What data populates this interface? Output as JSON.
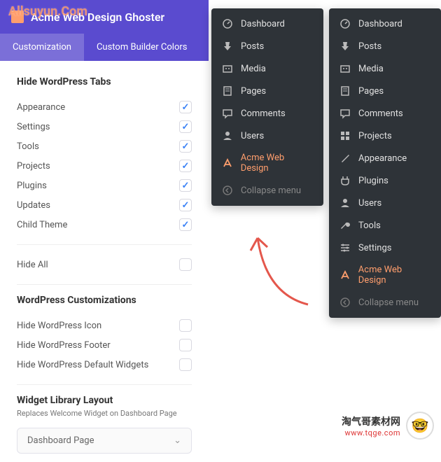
{
  "watermarks": {
    "top": "Allsuyun.Com",
    "bottom_title": "淘气哥素材网",
    "bottom_url": "www.tqge.com"
  },
  "panel": {
    "title": "Acme Web Design Ghoster",
    "tabs": [
      "Customization",
      "Custom Builder Colors"
    ],
    "active_tab": 0,
    "sections": {
      "hide_tabs": {
        "title": "Hide WordPress Tabs",
        "items": [
          {
            "label": "Appearance",
            "checked": true
          },
          {
            "label": "Settings",
            "checked": true
          },
          {
            "label": "Tools",
            "checked": true
          },
          {
            "label": "Projects",
            "checked": true
          },
          {
            "label": "Plugins",
            "checked": true
          },
          {
            "label": "Updates",
            "checked": true
          },
          {
            "label": "Child Theme",
            "checked": true
          }
        ],
        "hide_all": {
          "label": "Hide All",
          "checked": false
        }
      },
      "customizations": {
        "title": "WordPress Customizations",
        "items": [
          {
            "label": "Hide WordPress Icon",
            "checked": false
          },
          {
            "label": "Hide WordPress Footer",
            "checked": false
          },
          {
            "label": "Hide WordPress Default Widgets",
            "checked": false
          }
        ]
      },
      "widget": {
        "title": "Widget Library Layout",
        "subtitle": "Replaces Welcome Widget on Dashboard Page",
        "select_value": "Dashboard Page"
      }
    }
  },
  "menu_left": [
    {
      "icon": "dashboard",
      "label": "Dashboard"
    },
    {
      "icon": "pin",
      "label": "Posts"
    },
    {
      "icon": "media",
      "label": "Media"
    },
    {
      "icon": "page",
      "label": "Pages"
    },
    {
      "icon": "comment",
      "label": "Comments"
    },
    {
      "icon": "user",
      "label": "Users"
    },
    {
      "icon": "acme",
      "label": "Acme Web Design",
      "accent": true
    },
    {
      "icon": "collapse",
      "label": "Collapse menu",
      "collapse": true
    }
  ],
  "menu_right": [
    {
      "icon": "dashboard",
      "label": "Dashboard"
    },
    {
      "icon": "pin",
      "label": "Posts"
    },
    {
      "icon": "media",
      "label": "Media"
    },
    {
      "icon": "page",
      "label": "Pages"
    },
    {
      "icon": "comment",
      "label": "Comments"
    },
    {
      "icon": "project",
      "label": "Projects"
    },
    {
      "icon": "brush",
      "label": "Appearance"
    },
    {
      "icon": "plugin",
      "label": "Plugins"
    },
    {
      "icon": "user",
      "label": "Users"
    },
    {
      "icon": "wrench",
      "label": "Tools"
    },
    {
      "icon": "sliders",
      "label": "Settings"
    },
    {
      "icon": "acme",
      "label": "Acme Web Design",
      "accent": true
    },
    {
      "icon": "collapse",
      "label": "Collapse menu",
      "collapse": true
    }
  ]
}
